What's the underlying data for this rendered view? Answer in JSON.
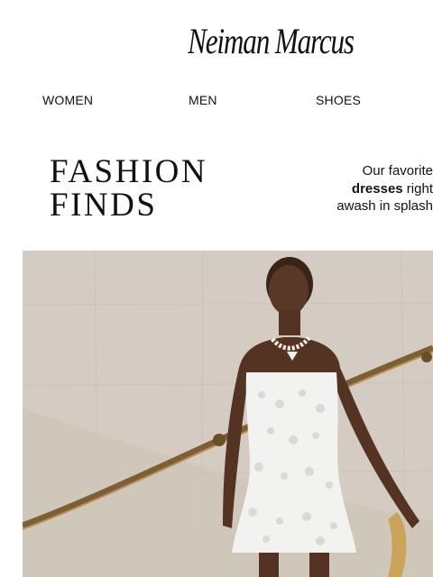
{
  "brand": {
    "logo_text": "Neiman Marcus"
  },
  "nav": {
    "items": [
      "WOMEN",
      "MEN",
      "SHOES"
    ]
  },
  "section": {
    "headline_line1": "FASHION",
    "headline_line2": "FINDS"
  },
  "promo": {
    "line1": "Our favorite",
    "line2_bold": "dresses",
    "line2_rest": " right",
    "line3": "awash in splash"
  },
  "colors": {
    "text": "#111111",
    "background": "#ffffff",
    "wall": "#d4ccc2",
    "dress": "#f2f2f0",
    "railing": "#8a6a3a"
  }
}
